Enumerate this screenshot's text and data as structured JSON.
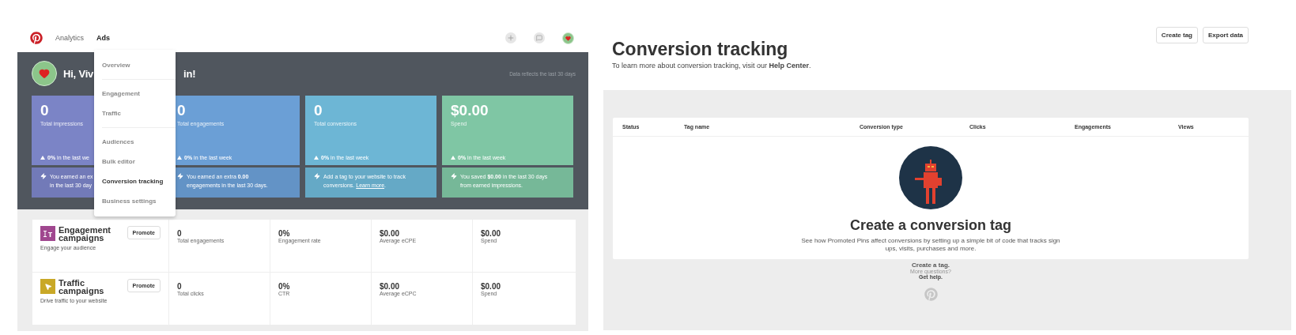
{
  "ads_page": {
    "nav": {
      "links": [
        {
          "label": "Analytics",
          "selected": false
        },
        {
          "label": "Ads",
          "selected": true
        }
      ]
    },
    "greeting": {
      "start": "Hi, Viv",
      "end": "in!"
    },
    "note": "Data reflects the last 30 days",
    "cards": [
      {
        "value": "0",
        "label": "Total impressions",
        "change": "**0%** in the last we",
        "tip_lines": [
          "You earned an ex",
          "in the last 30 day"
        ],
        "color": "#7b84c6"
      },
      {
        "value": "0",
        "label": "Total engagements",
        "change": "**0%** in the last week",
        "tip_lines": [
          "You earned an extra **0.00**",
          "engagements in the last 30 days."
        ],
        "color": "#6b9fd6"
      },
      {
        "value": "0",
        "label": "Total conversions",
        "change": "**0%** in the last week",
        "tip_lines": [
          "Add a tag to your website to track",
          "conversions."
        ],
        "link": "Learn more",
        "link_after": ".",
        "color": "#6db6d5"
      },
      {
        "value": "$0.00",
        "label": "Spend",
        "change": "**0%** in the last week",
        "tip_lines": [
          "You saved **$0.00** in the last 30 days",
          "from earned impressions."
        ],
        "color": "#7fc6a4"
      }
    ],
    "dropdown": {
      "groups": [
        [
          {
            "label": "Overview",
            "selected": false
          }
        ],
        [
          {
            "label": "Engagement",
            "selected": false
          },
          {
            "label": "Traffic",
            "selected": false
          }
        ],
        [
          {
            "label": "Audiences",
            "selected": false
          },
          {
            "label": "Bulk editor",
            "selected": false
          },
          {
            "label": "Conversion tracking",
            "selected": true
          },
          {
            "label": "Business settings",
            "selected": false
          }
        ]
      ]
    },
    "campaigns": [
      {
        "kind": "engagement",
        "color": "#a0478f",
        "title": "Engagement campaigns",
        "subtitle": "Engage your audience",
        "button": "Promote",
        "metrics": [
          {
            "value": "0",
            "label": "Total engagements"
          },
          {
            "value": "0%",
            "label": "Engagement rate"
          },
          {
            "value": "$0.00",
            "label": "Average eCPE"
          },
          {
            "value": "$0.00",
            "label": "Spend"
          }
        ]
      },
      {
        "kind": "traffic",
        "color": "#c9a827",
        "title": "Traffic campaigns",
        "subtitle": "Drive traffic to your website",
        "button": "Promote",
        "metrics": [
          {
            "value": "0",
            "label": "Total clicks"
          },
          {
            "value": "0%",
            "label": "CTR"
          },
          {
            "value": "$0.00",
            "label": "Average eCPC"
          },
          {
            "value": "$0.00",
            "label": "Spend"
          }
        ]
      }
    ]
  },
  "tracking_page": {
    "title": "Conversion tracking",
    "subtitle": "To learn more about conversion tracking, visit our **Help Center**.",
    "buttons": [
      "Create tag",
      "Export data"
    ],
    "table": {
      "columns": [
        "Status",
        "Tag name",
        "Conversion type",
        "Clicks",
        "Engagements",
        "Views"
      ]
    },
    "empty_state": {
      "title": "Create a conversion tag",
      "description": "See how Promoted Pins affect conversions by setting up a simple bit of code that tracks sign ups, visits, purchases and more."
    },
    "footer": {
      "cta": "Create a tag.",
      "question": "More questions?",
      "help": "Get help."
    }
  }
}
